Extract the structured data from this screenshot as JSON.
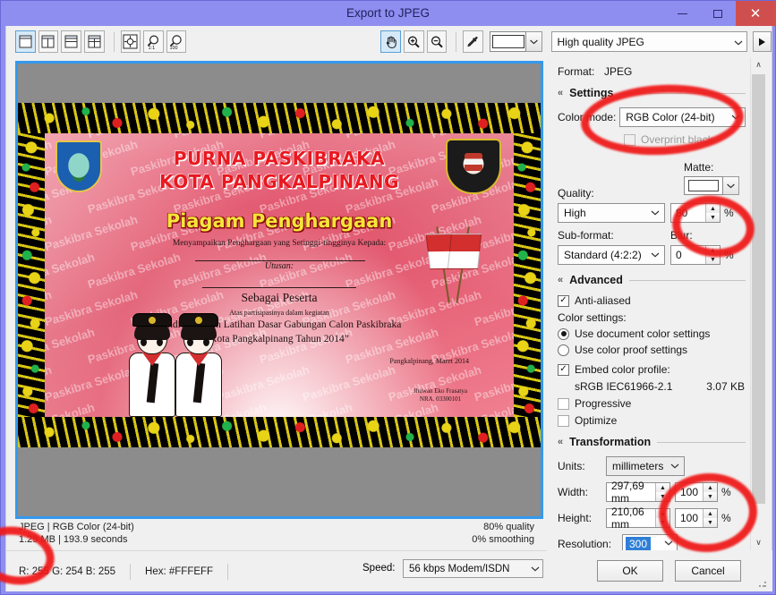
{
  "window": {
    "title": "Export to JPEG",
    "minimize_label": "–",
    "maximize_label": "□",
    "close_label": "✕"
  },
  "toolbar": {
    "layout_single": "single-pane-view",
    "layout_two_vertical": "two-pane-vertical-view",
    "layout_two_horizontal": "two-pane-horizontal-view",
    "layout_four": "four-pane-view",
    "fit_label": "fit-to-window",
    "zoom_1to1_label": "1:1",
    "zoom_100_label": "100",
    "hand_label": "hand-tool",
    "zoom_in_label": "+",
    "zoom_out_label": "–",
    "eyedropper_label": "eyedropper",
    "swatch_color": "#ffffff",
    "preset": "High quality JPEG",
    "preset_arrow": "∨",
    "play_label": "▶"
  },
  "preview": {
    "background_color": "#8c8c8c",
    "border_color": "#3399ee",
    "certificate": {
      "title_line1": "PURNA PASKIBRAKA",
      "title_line2": "KOTA PANGKALPINANG",
      "subtitle": "Piagam Penghargaan",
      "line_kepada": "Menyampaikan Penghargaan yang Setinggi-tingginya Kepada:",
      "utusan_label": "Utusan:",
      "role": "Sebagai Peserta",
      "participation": "Atas partisipasinya dalam kegiatan",
      "event_line1": "Pendidikan dan Latihan Dasar Gabungan Calon Paskibraka",
      "event_line2": "Kota Pangkalpinang Tahun 2014”",
      "place_date": "Pangkalpinang,    Maret 2014",
      "signer_name": "Jhuwan Eko Frasatya",
      "signer_nra": "NRA. 03300101",
      "watermark_text": "Paskibra Sekolah",
      "logo_left_name": "pangkalpinang-city-emblem",
      "logo_right_name": "paskibraka-emblem",
      "flag_name": "indonesian-flag-pair"
    }
  },
  "info": {
    "format_line": "JPEG  |  RGB Color (24-bit)",
    "size_line": "1.29 MB  |  193.9 seconds",
    "quality_line": "80% quality",
    "smoothing_line": "0% smoothing"
  },
  "status": {
    "rgb": "R: 255  G: 254  B: 255",
    "hex": "Hex: #FFFEFF",
    "speed_label": "Speed:",
    "speed_value": "56 kbps Modem/ISDN",
    "speed_arrow": "∨"
  },
  "panel": {
    "format_label": "Format:",
    "format_value": "JPEG",
    "settings": {
      "heading": "Settings",
      "collapse_glyph": "«",
      "color_mode_label": "Color mode:",
      "color_mode_value": "RGB Color (24-bit)",
      "overprint_label": "Overprint black",
      "overprint_checked": false,
      "matte_label": "Matte:",
      "matte_color": "#ffffff",
      "quality_label": "Quality:",
      "quality_value": "High",
      "quality_percent": "80",
      "percent_sign": "%",
      "subformat_label": "Sub-format:",
      "subformat_value": "Standard (4:2:2)",
      "blur_label": "Blur:",
      "blur_value": "0"
    },
    "advanced": {
      "heading": "Advanced",
      "collapse_glyph": "«",
      "anti_aliased_label": "Anti-aliased",
      "anti_aliased_checked": true,
      "color_settings_label": "Color settings:",
      "radio_document_label": "Use document color settings",
      "radio_proof_label": "Use color proof settings",
      "radio_selected": "document",
      "embed_profile_label": "Embed color profile:",
      "embed_profile_checked": true,
      "profile_name": "sRGB IEC61966-2.1",
      "profile_size": "3.07 KB",
      "progressive_label": "Progressive",
      "progressive_checked": false,
      "optimize_label": "Optimize",
      "optimize_checked": false
    },
    "transformation": {
      "heading": "Transformation",
      "collapse_glyph": "«",
      "units_label": "Units:",
      "units_value": "millimeters",
      "width_label": "Width:",
      "width_value": "297,69 mm",
      "width_percent": "100",
      "height_label": "Height:",
      "height_value": "210,06 mm",
      "height_percent": "100",
      "percent_sign": "%",
      "resolution_label": "Resolution:",
      "resolution_value": "300"
    },
    "scroll_up_glyph": "∧",
    "scroll_down_glyph": "∨"
  },
  "buttons": {
    "ok": "OK",
    "cancel": "Cancel"
  },
  "annotations": {
    "color": "#ef1717",
    "items": [
      "color-mode-circle",
      "quality-circle",
      "transformation-circle",
      "file-size-circle"
    ]
  }
}
